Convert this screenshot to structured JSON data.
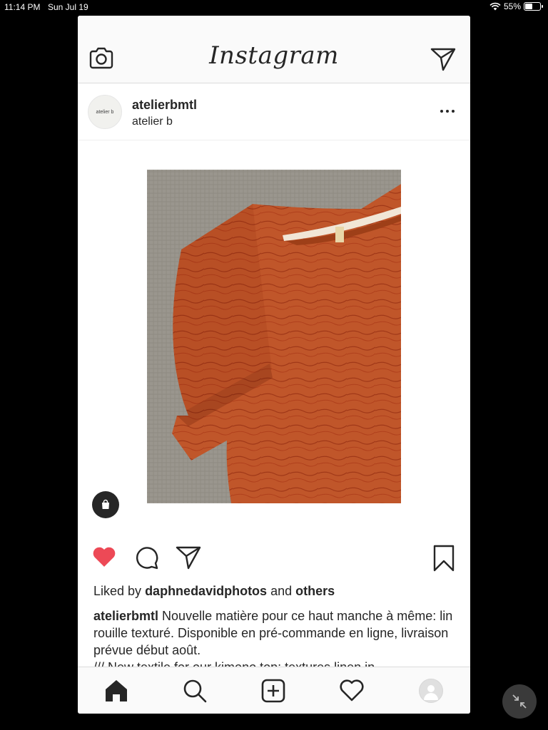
{
  "status_bar": {
    "time": "11:14 PM",
    "date": "Sun Jul 19",
    "battery": "55%",
    "battery_level": 0.55
  },
  "header": {
    "logo": "Instagram",
    "left_icon": "camera-icon",
    "right_icon": "direct-send-icon"
  },
  "post": {
    "avatar_text": "atelier b",
    "username": "atelierbmtl",
    "location": "atelier b",
    "liked_by_prefix": "Liked by",
    "liked_by_user": "daphnedavidphotos",
    "liked_by_and": "and",
    "liked_by_others": "others",
    "caption_user": "atelierbmtl",
    "caption_text": "Nouvelle matière pour ce haut manche à même: lin rouille texturé. Disponible en pré-commande en ligne, livraison prévue début août.",
    "caption_line2": "/// New textile for our kimono top: textures linen in",
    "liked": true,
    "colors": {
      "like": "#ed4956",
      "shirt": "#c0562a",
      "background_fabric": "#9c9890"
    }
  },
  "tabbar": {
    "icons": [
      "home-icon",
      "search-icon",
      "add-post-icon",
      "activity-heart-icon",
      "profile-icon"
    ]
  }
}
